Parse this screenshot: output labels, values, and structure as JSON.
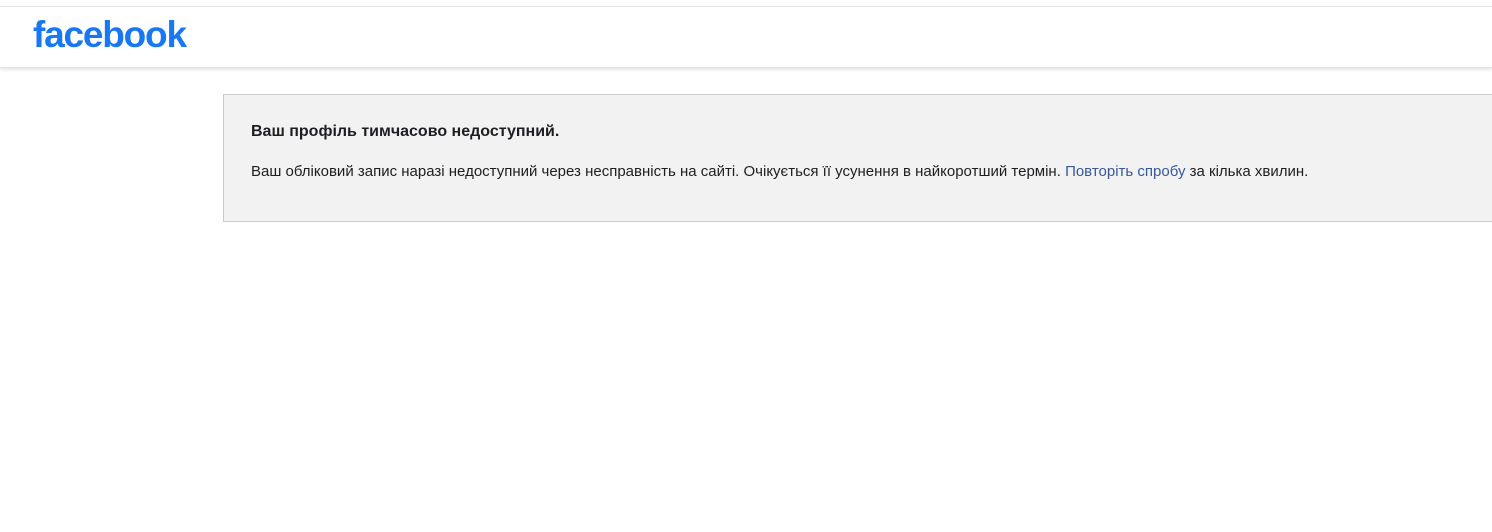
{
  "header": {
    "logo_text": "facebook",
    "brand_color": "#1877f2"
  },
  "notice": {
    "title": "Ваш профіль тимчасово недоступний.",
    "body_before_link": "Ваш обліковий запис наразі недоступний через несправність на сайті. Очікується її усунення в найкоротший термін. ",
    "link_text": "Повторіть спробу",
    "body_after_link": " за кілька хвилин.",
    "link_color": "#385898"
  }
}
